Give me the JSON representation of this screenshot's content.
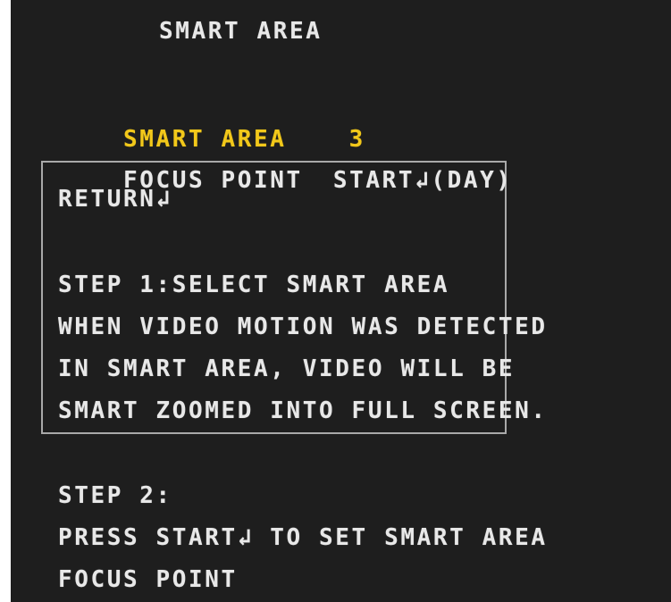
{
  "osd": {
    "menu_title": "SMART AREA",
    "smart_area": {
      "label": "SMART AREA",
      "value": "3"
    },
    "focus_point": {
      "label": "FOCUS POINT",
      "action": "START↲",
      "mode": "(DAY)"
    },
    "return_label": "RETURN↲",
    "step1": {
      "heading": "STEP 1:SELECT SMART AREA",
      "lines": [
        "WHEN VIDEO MOTION WAS DETECTED",
        "IN SMART AREA, VIDEO WILL BE",
        "SMART ZOOMED INTO FULL SCREEN."
      ]
    },
    "step2": {
      "heading": "STEP 2:",
      "lines": [
        "PRESS START↲ TO SET SMART AREA",
        "FOCUS POINT"
      ]
    },
    "colors": {
      "background": "#1e1e1e",
      "text": "#e8e8e8",
      "highlight": "#f2c81a",
      "box": "#a9a9a9"
    }
  }
}
